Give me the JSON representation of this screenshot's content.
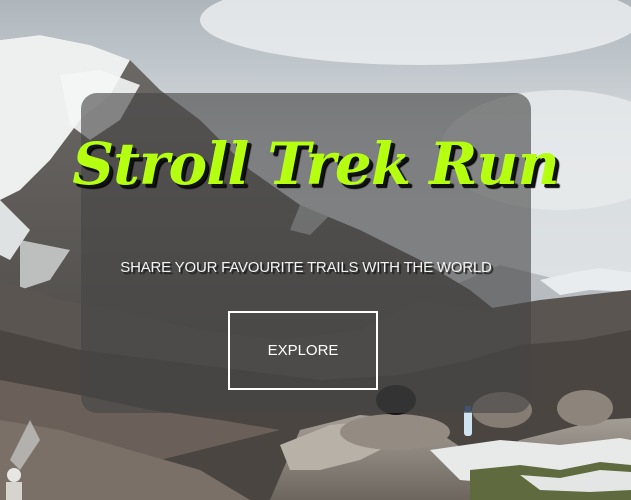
{
  "hero": {
    "title": "Stroll Trek Run",
    "subtitle": "SHARE YOUR FAVOURITE TRAILS WITH THE WORLD",
    "button_label": "EXPLORE"
  },
  "colors": {
    "title": "#b5ff10",
    "card_overlay": "rgba(70,70,70,0.62)",
    "button_border": "#ffffff"
  },
  "background": {
    "scene": "mountain-landscape"
  }
}
